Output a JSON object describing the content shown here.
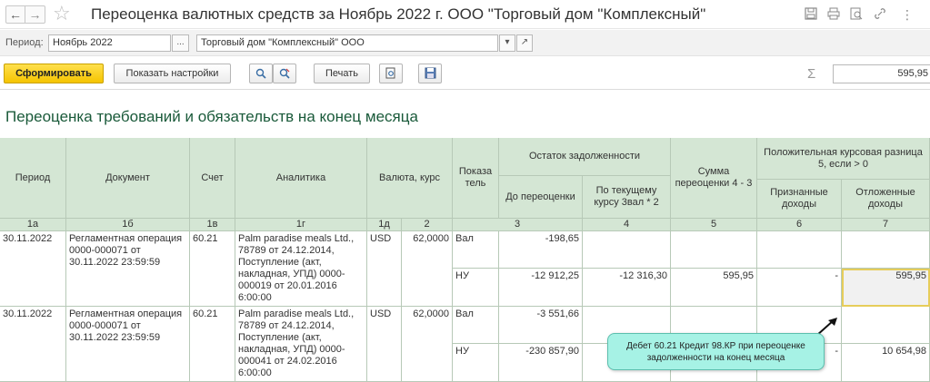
{
  "window": {
    "title": "Переоценка валютных средств за Ноябрь 2022 г. ООО \"Торговый дом \"Комплексный\"",
    "icons": [
      "save-icon",
      "print-icon",
      "preview-icon",
      "link-icon",
      "more-icon"
    ]
  },
  "params": {
    "period_label": "Период:",
    "period_value": "Ноябрь 2022",
    "period_button": "...",
    "org_value": "Торговый дом \"Комплексный\" ООО"
  },
  "toolbar": {
    "generate_label": "Сформировать",
    "settings_label": "Показать настройки",
    "print_label": "Печать",
    "sum_value": "595,95"
  },
  "report": {
    "title": "Переоценка требований и обязательств на конец месяца",
    "headers": {
      "period": "Период",
      "document": "Документ",
      "account": "Счет",
      "analytics": "Аналитика",
      "currency": "Валюта, курс",
      "indicator": "Показа тель",
      "balance": "Остаток задолженности",
      "before": "До переоценки",
      "current": "По текущему курсу 3вал * 2",
      "sum": "Сумма переоценки 4 - 3",
      "positive": "Положительная курсовая разница 5, если > 0",
      "recognized": "Признанные доходы",
      "deferred": "Отложенные доходы"
    },
    "col_numbers": [
      "1а",
      "1б",
      "1в",
      "1г",
      "1д",
      "2",
      "3",
      "4",
      "5",
      "6",
      "7"
    ],
    "rows": [
      {
        "period": "30.11.2022",
        "document": "Регламентная операция 0000-000071 от 30.11.2022 23:59:59",
        "account": "60.21",
        "analytics": "Palm paradise meals Ltd., 78789 от 24.12.2014, Поступление (акт, накладная, УПД) 0000-000019 от 20.01.2016 6:00:00",
        "currency": "USD",
        "rate": "62,0000",
        "lines": [
          {
            "indicator": "Вал",
            "before": "-198,65",
            "current": "",
            "sum": "",
            "recognized": "",
            "deferred": ""
          },
          {
            "indicator": "НУ",
            "before": "-12 912,25",
            "current": "-12 316,30",
            "sum": "595,95",
            "recognized": "-",
            "deferred": "595,95"
          }
        ]
      },
      {
        "period": "30.11.2022",
        "document": "Регламентная операция 0000-000071 от 30.11.2022 23:59:59",
        "account": "60.21",
        "analytics": "Palm paradise meals Ltd., 78789 от 24.12.2014, Поступление (акт, накладная, УПД) 0000-000041 от 24.02.2016 6:00:00",
        "currency": "USD",
        "rate": "62,0000",
        "lines": [
          {
            "indicator": "Вал",
            "before": "-3 551,66",
            "current": "",
            "sum": "",
            "recognized": "",
            "deferred": ""
          },
          {
            "indicator": "НУ",
            "before": "-230 857,90",
            "current": "",
            "sum": "",
            "recognized": "-",
            "deferred": "10 654,98"
          }
        ]
      }
    ]
  },
  "callout": {
    "text": "Дебет 60.21 Кредит 98.КР при переоценке задолженности на конец месяца"
  }
}
